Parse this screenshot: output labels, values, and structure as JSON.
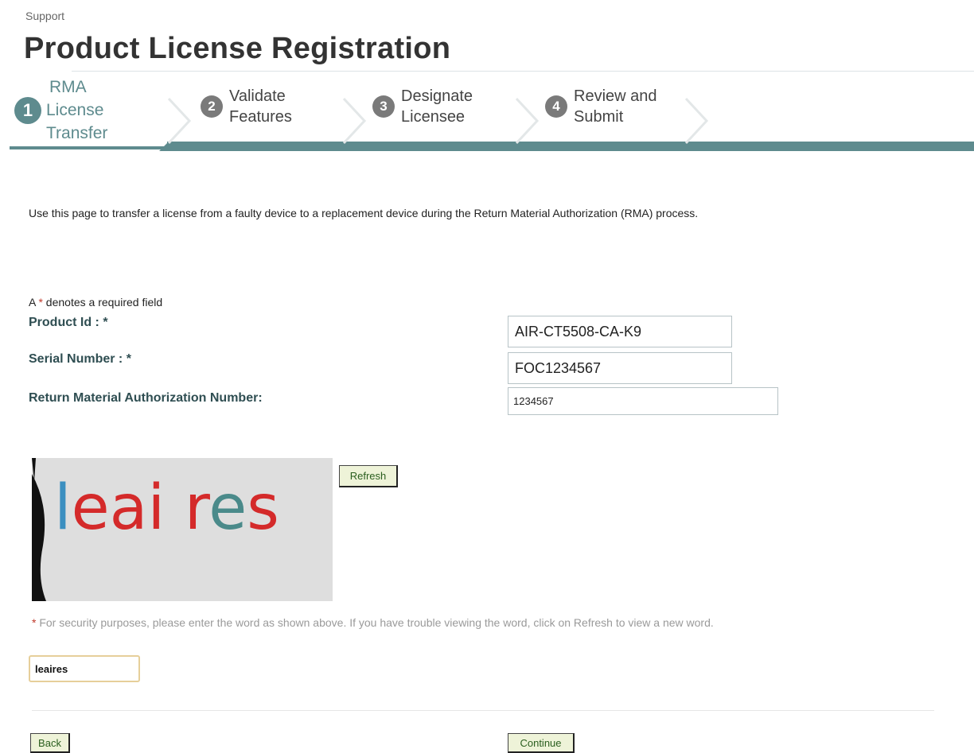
{
  "header": {
    "section": "Support",
    "title": "Product License Registration"
  },
  "wizard": {
    "steps": [
      {
        "number": "1",
        "line1": "RMA",
        "line2": "License",
        "line3": "Transfer",
        "active": true
      },
      {
        "number": "2",
        "line1": "Validate",
        "line2": "Features",
        "active": false
      },
      {
        "number": "3",
        "line1": "Designate",
        "line2": "Licensee",
        "active": false
      },
      {
        "number": "4",
        "line1": "Review and",
        "line2": "Submit",
        "active": false
      }
    ],
    "colors": {
      "active": "#5e8b8e",
      "inactive": "#7a7a7a"
    }
  },
  "intro": "Use this page to transfer a license from a faulty device to a replacement device during the Return Material Authorization (RMA) process.",
  "form": {
    "required_note_prefix": "A ",
    "required_star": "*",
    "required_note_suffix": " denotes a required field",
    "product_id": {
      "label": "Product Id : *",
      "value": "AIR-CT5508-CA-K9"
    },
    "serial_number": {
      "label": "Serial Number : *",
      "value": "FOC1234567"
    },
    "rma_number": {
      "label": "Return Material Authorization Number:",
      "value": "1234567"
    }
  },
  "captcha": {
    "word": "leaires",
    "refresh_label": "Refresh",
    "note_star": "*",
    "note": " For security purposes, please enter the word as shown above. If you have trouble viewing the word, click on Refresh to view a new word.",
    "input_value": "leaires"
  },
  "actions": {
    "back_label": "Back",
    "continue_label": "Continue"
  }
}
